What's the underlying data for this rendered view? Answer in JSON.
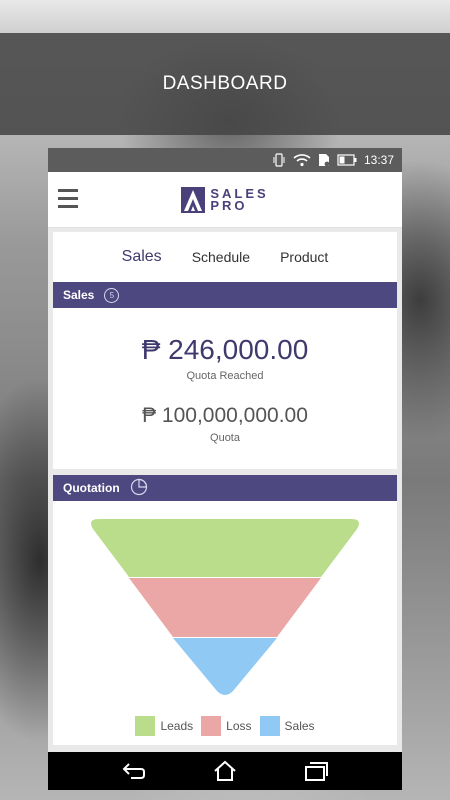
{
  "header": {
    "title": "DASHBOARD"
  },
  "status_bar": {
    "time": "13:37"
  },
  "app": {
    "logo_line1": "SALES",
    "logo_line2": "PRO"
  },
  "tabs": [
    {
      "label": "Sales",
      "active": true
    },
    {
      "label": "Schedule",
      "active": false
    },
    {
      "label": "Product",
      "active": false
    }
  ],
  "sales_section": {
    "title": "Sales",
    "badge": "5",
    "quota_reached_value": "₱ 246,000.00",
    "quota_reached_label": "Quota Reached",
    "quota_value": "₱ 100,000,000.00",
    "quota_label": "Quota"
  },
  "quotation_section": {
    "title": "Quotation"
  },
  "chart_data": {
    "type": "funnel",
    "categories": [
      "Leads",
      "Loss",
      "Sales"
    ],
    "colors": [
      "#b9dd8a",
      "#eba6a6",
      "#90caf4"
    ],
    "legend_position": "bottom"
  },
  "colors": {
    "accent": "#4e4880",
    "leads": "#b9dd8a",
    "loss": "#eba6a6",
    "sales": "#90caf4"
  }
}
